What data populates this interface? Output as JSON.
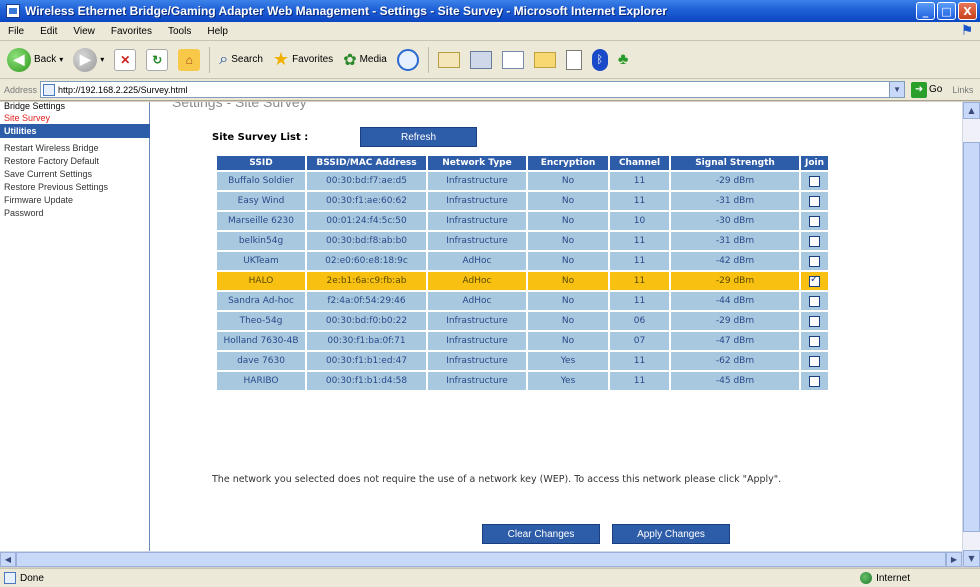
{
  "window": {
    "title": "Wireless Ethernet Bridge/Gaming Adapter Web Management - Settings - Site Survey - Microsoft Internet Explorer",
    "minimize": "_",
    "maximize": "□",
    "close": "X"
  },
  "menu": [
    "File",
    "Edit",
    "View",
    "Favorites",
    "Tools",
    "Help"
  ],
  "toolbar": {
    "back": "Back",
    "search": "Search",
    "favorites": "Favorites",
    "media": "Media"
  },
  "address": {
    "label": "Address",
    "url": "http://192.168.2.225/Survey.html",
    "go": "Go",
    "links": "Links"
  },
  "sidebar": {
    "top_item": "Bridge Settings",
    "active_item": "Site Survey",
    "section_header": "Utilities",
    "items": [
      "Restart Wireless Bridge",
      "Restore Factory Default",
      "Save Current Settings",
      "Restore Previous Settings",
      "Firmware Update",
      "Password"
    ]
  },
  "page": {
    "heading": "Settings - Site Survey",
    "site_survey_label": "Site Survey List :",
    "refresh_label": "Refresh",
    "note": "The network you selected does not require the use of a network key (WEP). To access this network please click \"Apply\".",
    "clear_label": "Clear Changes",
    "apply_label": "Apply Changes"
  },
  "table": {
    "headers": [
      "SSID",
      "BSSID/MAC Address",
      "Network Type",
      "Encryption",
      "Channel",
      "Signal Strength",
      "Join"
    ],
    "rows": [
      {
        "ssid": "Buffalo Soldier",
        "bssid": "00:30:bd:f7:ae:d5",
        "type": "Infrastructure",
        "enc": "No",
        "channel": "11",
        "signal": "-29 dBm",
        "join": false
      },
      {
        "ssid": "Easy Wind",
        "bssid": "00:30:f1:ae:60:62",
        "type": "Infrastructure",
        "enc": "No",
        "channel": "11",
        "signal": "-31 dBm",
        "join": false
      },
      {
        "ssid": "Marseille 6230",
        "bssid": "00:01:24:f4:5c:50",
        "type": "Infrastructure",
        "enc": "No",
        "channel": "10",
        "signal": "-30 dBm",
        "join": false
      },
      {
        "ssid": "belkin54g",
        "bssid": "00:30:bd:f8:ab:b0",
        "type": "Infrastructure",
        "enc": "No",
        "channel": "11",
        "signal": "-31 dBm",
        "join": false
      },
      {
        "ssid": "UKTeam",
        "bssid": "02:e0:60:e8:18:9c",
        "type": "AdHoc",
        "enc": "No",
        "channel": "11",
        "signal": "-42 dBm",
        "join": false
      },
      {
        "ssid": "HALO",
        "bssid": "2e:b1:6a:c9:fb:ab",
        "type": "AdHoc",
        "enc": "No",
        "channel": "11",
        "signal": "-29 dBm",
        "join": true,
        "selected": true
      },
      {
        "ssid": "Sandra Ad-hoc",
        "bssid": "f2:4a:0f:54:29:46",
        "type": "AdHoc",
        "enc": "No",
        "channel": "11",
        "signal": "-44 dBm",
        "join": false
      },
      {
        "ssid": "Theo-54g",
        "bssid": "00:30:bd:f0:b0:22",
        "type": "Infrastructure",
        "enc": "No",
        "channel": "06",
        "signal": "-29 dBm",
        "join": false
      },
      {
        "ssid": "Holland 7630-4B",
        "bssid": "00:30:f1:ba:0f:71",
        "type": "Infrastructure",
        "enc": "No",
        "channel": "07",
        "signal": "-47 dBm",
        "join": false
      },
      {
        "ssid": "dave 7630",
        "bssid": "00:30:f1:b1:ed:47",
        "type": "Infrastructure",
        "enc": "Yes",
        "channel": "11",
        "signal": "-62 dBm",
        "join": false
      },
      {
        "ssid": "HARIBO",
        "bssid": "00:30:f1:b1:d4:58",
        "type": "Infrastructure",
        "enc": "Yes",
        "channel": "11",
        "signal": "-45 dBm",
        "join": false
      }
    ]
  },
  "status": {
    "text": "Done",
    "zone": "Internet"
  },
  "colors": {
    "header_blue": "#2d5ca8",
    "row_blue": "#a8c8e0",
    "selected_row": "#f8c010"
  }
}
